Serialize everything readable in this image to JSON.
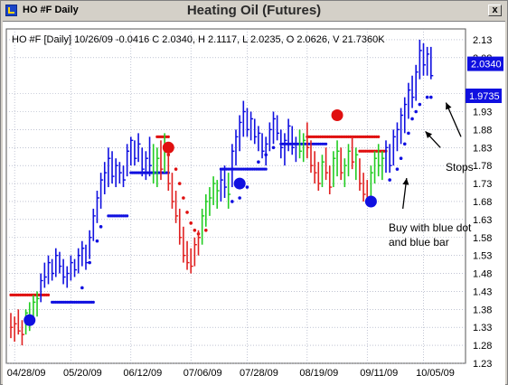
{
  "window": {
    "title": "HO #F Daily",
    "chart_title": "Heating Oil (Futures)",
    "close_glyph": "x"
  },
  "info_line": "HO #F [Daily] 10/26/09  -0.0416 C 2.0340, H 2.1117, L 2.0235, O 2.0626, V 21.7360K",
  "colors": {
    "up": "#22cc22",
    "down": "#e02020",
    "blue_bar": "#1010e0",
    "blue_dot": "#1010e0",
    "red_dot": "#e01010",
    "badge": "#1010e0",
    "grid": "#9aa0b8"
  },
  "annotations": {
    "stops": "Stops",
    "buy_line1": "Buy with blue dot",
    "buy_line2": "and blue bar"
  },
  "chart_data": {
    "type": "bar",
    "title": "Heating Oil (Futures)",
    "xlabel": "",
    "ylabel": "",
    "ylim": [
      1.23,
      2.16
    ],
    "y_ticks": [
      2.13,
      2.08,
      1.98,
      1.93,
      1.88,
      1.83,
      1.78,
      1.73,
      1.68,
      1.63,
      1.58,
      1.53,
      1.48,
      1.43,
      1.38,
      1.33,
      1.28,
      1.23
    ],
    "x_ticks": [
      {
        "label": "04/28/09",
        "bar": 1
      },
      {
        "label": "05/20/09",
        "bar": 16
      },
      {
        "label": "06/12/09",
        "bar": 32
      },
      {
        "label": "07/06/09",
        "bar": 48
      },
      {
        "label": "07/28/09",
        "bar": 63
      },
      {
        "label": "08/19/09",
        "bar": 79
      },
      {
        "label": "09/11/09",
        "bar": 95
      },
      {
        "label": "10/05/09",
        "bar": 110
      }
    ],
    "last_price": "2.0340",
    "stop_price": "1.9735",
    "bars": [
      {
        "h": 1.37,
        "l": 1.3,
        "c": 1.33,
        "k": "d"
      },
      {
        "h": 1.36,
        "l": 1.29,
        "c": 1.34,
        "k": "d"
      },
      {
        "h": 1.38,
        "l": 1.31,
        "c": 1.32,
        "k": "d"
      },
      {
        "h": 1.35,
        "l": 1.28,
        "c": 1.31,
        "k": "d"
      },
      {
        "h": 1.38,
        "l": 1.31,
        "c": 1.37,
        "k": "u"
      },
      {
        "h": 1.4,
        "l": 1.32,
        "c": 1.36,
        "k": "u"
      },
      {
        "h": 1.42,
        "l": 1.34,
        "c": 1.4,
        "k": "u"
      },
      {
        "h": 1.43,
        "l": 1.36,
        "c": 1.41,
        "k": "u"
      },
      {
        "h": 1.48,
        "l": 1.4,
        "c": 1.46,
        "k": "b"
      },
      {
        "h": 1.51,
        "l": 1.44,
        "c": 1.47,
        "k": "b"
      },
      {
        "h": 1.53,
        "l": 1.45,
        "c": 1.51,
        "k": "b"
      },
      {
        "h": 1.52,
        "l": 1.46,
        "c": 1.48,
        "k": "b"
      },
      {
        "h": 1.55,
        "l": 1.47,
        "c": 1.53,
        "k": "b"
      },
      {
        "h": 1.54,
        "l": 1.48,
        "c": 1.5,
        "k": "b"
      },
      {
        "h": 1.52,
        "l": 1.45,
        "c": 1.47,
        "k": "b"
      },
      {
        "h": 1.5,
        "l": 1.44,
        "c": 1.48,
        "k": "b"
      },
      {
        "h": 1.53,
        "l": 1.46,
        "c": 1.51,
        "k": "b"
      },
      {
        "h": 1.52,
        "l": 1.47,
        "c": 1.49,
        "k": "b"
      },
      {
        "h": 1.55,
        "l": 1.48,
        "c": 1.53,
        "k": "b"
      },
      {
        "h": 1.57,
        "l": 1.5,
        "c": 1.55,
        "k": "b"
      },
      {
        "h": 1.56,
        "l": 1.49,
        "c": 1.51,
        "k": "b"
      },
      {
        "h": 1.6,
        "l": 1.52,
        "c": 1.58,
        "k": "b"
      },
      {
        "h": 1.66,
        "l": 1.57,
        "c": 1.64,
        "k": "b"
      },
      {
        "h": 1.71,
        "l": 1.62,
        "c": 1.69,
        "k": "b"
      },
      {
        "h": 1.76,
        "l": 1.66,
        "c": 1.74,
        "k": "b"
      },
      {
        "h": 1.79,
        "l": 1.7,
        "c": 1.76,
        "k": "b"
      },
      {
        "h": 1.83,
        "l": 1.72,
        "c": 1.8,
        "k": "b"
      },
      {
        "h": 1.82,
        "l": 1.73,
        "c": 1.75,
        "k": "b"
      },
      {
        "h": 1.8,
        "l": 1.72,
        "c": 1.78,
        "k": "b"
      },
      {
        "h": 1.79,
        "l": 1.73,
        "c": 1.76,
        "k": "b"
      },
      {
        "h": 1.78,
        "l": 1.72,
        "c": 1.74,
        "k": "b"
      },
      {
        "h": 1.84,
        "l": 1.75,
        "c": 1.82,
        "k": "b"
      },
      {
        "h": 1.86,
        "l": 1.78,
        "c": 1.85,
        "k": "b"
      },
      {
        "h": 1.85,
        "l": 1.78,
        "c": 1.8,
        "k": "b"
      },
      {
        "h": 1.87,
        "l": 1.79,
        "c": 1.84,
        "k": "b"
      },
      {
        "h": 1.83,
        "l": 1.75,
        "c": 1.77,
        "k": "b"
      },
      {
        "h": 1.82,
        "l": 1.74,
        "c": 1.8,
        "k": "b"
      },
      {
        "h": 1.86,
        "l": 1.75,
        "c": 1.78,
        "k": "b"
      },
      {
        "h": 1.84,
        "l": 1.73,
        "c": 1.76,
        "k": "u"
      },
      {
        "h": 1.83,
        "l": 1.72,
        "c": 1.8,
        "k": "u"
      },
      {
        "h": 1.85,
        "l": 1.74,
        "c": 1.77,
        "k": "d"
      },
      {
        "h": 1.87,
        "l": 1.76,
        "c": 1.84,
        "k": "u"
      },
      {
        "h": 1.81,
        "l": 1.71,
        "c": 1.73,
        "k": "d"
      },
      {
        "h": 1.76,
        "l": 1.66,
        "c": 1.68,
        "k": "d"
      },
      {
        "h": 1.71,
        "l": 1.62,
        "c": 1.64,
        "k": "d"
      },
      {
        "h": 1.66,
        "l": 1.56,
        "c": 1.58,
        "k": "d"
      },
      {
        "h": 1.61,
        "l": 1.51,
        "c": 1.53,
        "k": "d"
      },
      {
        "h": 1.57,
        "l": 1.49,
        "c": 1.51,
        "k": "d"
      },
      {
        "h": 1.55,
        "l": 1.48,
        "c": 1.5,
        "k": "d"
      },
      {
        "h": 1.58,
        "l": 1.5,
        "c": 1.56,
        "k": "d"
      },
      {
        "h": 1.6,
        "l": 1.53,
        "c": 1.58,
        "k": "d"
      },
      {
        "h": 1.66,
        "l": 1.56,
        "c": 1.64,
        "k": "u"
      },
      {
        "h": 1.7,
        "l": 1.61,
        "c": 1.68,
        "k": "u"
      },
      {
        "h": 1.72,
        "l": 1.64,
        "c": 1.69,
        "k": "u"
      },
      {
        "h": 1.75,
        "l": 1.67,
        "c": 1.73,
        "k": "u"
      },
      {
        "h": 1.74,
        "l": 1.66,
        "c": 1.71,
        "k": "u"
      },
      {
        "h": 1.77,
        "l": 1.68,
        "c": 1.74,
        "k": "b"
      },
      {
        "h": 1.78,
        "l": 1.69,
        "c": 1.72,
        "k": "b"
      },
      {
        "h": 1.76,
        "l": 1.66,
        "c": 1.7,
        "k": "u"
      },
      {
        "h": 1.84,
        "l": 1.72,
        "c": 1.82,
        "k": "b"
      },
      {
        "h": 1.88,
        "l": 1.78,
        "c": 1.86,
        "k": "b"
      },
      {
        "h": 1.92,
        "l": 1.82,
        "c": 1.9,
        "k": "b"
      },
      {
        "h": 1.96,
        "l": 1.86,
        "c": 1.93,
        "k": "b"
      },
      {
        "h": 1.94,
        "l": 1.86,
        "c": 1.88,
        "k": "b"
      },
      {
        "h": 1.93,
        "l": 1.85,
        "c": 1.91,
        "k": "b"
      },
      {
        "h": 1.91,
        "l": 1.84,
        "c": 1.86,
        "k": "b"
      },
      {
        "h": 1.89,
        "l": 1.82,
        "c": 1.87,
        "k": "b"
      },
      {
        "h": 1.87,
        "l": 1.8,
        "c": 1.82,
        "k": "b"
      },
      {
        "h": 1.86,
        "l": 1.78,
        "c": 1.84,
        "k": "b"
      },
      {
        "h": 1.9,
        "l": 1.82,
        "c": 1.88,
        "k": "b"
      },
      {
        "h": 1.93,
        "l": 1.84,
        "c": 1.91,
        "k": "b"
      },
      {
        "h": 1.92,
        "l": 1.85,
        "c": 1.87,
        "k": "b"
      },
      {
        "h": 1.88,
        "l": 1.8,
        "c": 1.83,
        "k": "b"
      },
      {
        "h": 1.87,
        "l": 1.78,
        "c": 1.85,
        "k": "b"
      },
      {
        "h": 1.91,
        "l": 1.82,
        "c": 1.89,
        "k": "b"
      },
      {
        "h": 1.89,
        "l": 1.81,
        "c": 1.83,
        "k": "b"
      },
      {
        "h": 1.86,
        "l": 1.79,
        "c": 1.84,
        "k": "b"
      },
      {
        "h": 1.88,
        "l": 1.8,
        "c": 1.82,
        "k": "u"
      },
      {
        "h": 1.87,
        "l": 1.79,
        "c": 1.85,
        "k": "u"
      },
      {
        "h": 1.9,
        "l": 1.8,
        "c": 1.83,
        "k": "d"
      },
      {
        "h": 1.85,
        "l": 1.76,
        "c": 1.78,
        "k": "d"
      },
      {
        "h": 1.82,
        "l": 1.73,
        "c": 1.76,
        "k": "d"
      },
      {
        "h": 1.79,
        "l": 1.71,
        "c": 1.73,
        "k": "d"
      },
      {
        "h": 1.81,
        "l": 1.72,
        "c": 1.79,
        "k": "u"
      },
      {
        "h": 1.83,
        "l": 1.74,
        "c": 1.76,
        "k": "d"
      },
      {
        "h": 1.78,
        "l": 1.7,
        "c": 1.72,
        "k": "d"
      },
      {
        "h": 1.82,
        "l": 1.72,
        "c": 1.8,
        "k": "u"
      },
      {
        "h": 1.85,
        "l": 1.75,
        "c": 1.82,
        "k": "u"
      },
      {
        "h": 1.83,
        "l": 1.74,
        "c": 1.76,
        "k": "d"
      },
      {
        "h": 1.8,
        "l": 1.72,
        "c": 1.78,
        "k": "u"
      },
      {
        "h": 1.84,
        "l": 1.75,
        "c": 1.82,
        "k": "u"
      },
      {
        "h": 1.86,
        "l": 1.77,
        "c": 1.79,
        "k": "d"
      },
      {
        "h": 1.83,
        "l": 1.74,
        "c": 1.81,
        "k": "u"
      },
      {
        "h": 1.8,
        "l": 1.71,
        "c": 1.73,
        "k": "d"
      },
      {
        "h": 1.76,
        "l": 1.68,
        "c": 1.7,
        "k": "d"
      },
      {
        "h": 1.74,
        "l": 1.67,
        "c": 1.69,
        "k": "d"
      },
      {
        "h": 1.78,
        "l": 1.69,
        "c": 1.76,
        "k": "u"
      },
      {
        "h": 1.82,
        "l": 1.73,
        "c": 1.8,
        "k": "u"
      },
      {
        "h": 1.84,
        "l": 1.75,
        "c": 1.78,
        "k": "u"
      },
      {
        "h": 1.82,
        "l": 1.74,
        "c": 1.8,
        "k": "u"
      },
      {
        "h": 1.85,
        "l": 1.76,
        "c": 1.83,
        "k": "b"
      },
      {
        "h": 1.84,
        "l": 1.76,
        "c": 1.78,
        "k": "b"
      },
      {
        "h": 1.88,
        "l": 1.78,
        "c": 1.86,
        "k": "b"
      },
      {
        "h": 1.9,
        "l": 1.82,
        "c": 1.88,
        "k": "b"
      },
      {
        "h": 1.94,
        "l": 1.84,
        "c": 1.92,
        "k": "b"
      },
      {
        "h": 1.97,
        "l": 1.87,
        "c": 1.95,
        "k": "b"
      },
      {
        "h": 2.01,
        "l": 1.91,
        "c": 1.99,
        "k": "b"
      },
      {
        "h": 2.03,
        "l": 1.94,
        "c": 1.97,
        "k": "b"
      },
      {
        "h": 2.06,
        "l": 1.96,
        "c": 2.04,
        "k": "b"
      },
      {
        "h": 2.13,
        "l": 2.02,
        "c": 2.1,
        "k": "b"
      },
      {
        "h": 2.12,
        "l": 2.03,
        "c": 2.06,
        "k": "b"
      },
      {
        "h": 2.11,
        "l": 2.03,
        "c": 2.09,
        "k": "b"
      },
      {
        "h": 2.11,
        "l": 2.02,
        "c": 2.03,
        "k": "b"
      }
    ],
    "red_stops": [
      {
        "from": 0,
        "to": 10,
        "y": 1.42
      },
      {
        "from": 39,
        "to": 42,
        "y": 1.86
      },
      {
        "from": 79,
        "to": 98,
        "y": 1.86
      },
      {
        "from": 93,
        "to": 100,
        "y": 1.82
      }
    ],
    "blue_stops": [
      {
        "from": 11,
        "to": 22,
        "y": 1.4
      },
      {
        "from": 26,
        "to": 31,
        "y": 1.64
      },
      {
        "from": 32,
        "to": 42,
        "y": 1.76
      },
      {
        "from": 56,
        "to": 68,
        "y": 1.77
      },
      {
        "from": 72,
        "to": 84,
        "y": 1.84
      }
    ],
    "red_trail": [
      [
        42,
        1.81
      ],
      [
        44,
        1.77
      ],
      [
        45,
        1.73
      ],
      [
        46,
        1.69
      ],
      [
        47,
        1.65
      ],
      [
        48,
        1.62
      ],
      [
        49,
        1.6
      ],
      [
        50,
        1.59
      ],
      [
        52,
        1.6
      ]
    ],
    "blue_trail": [
      [
        19,
        1.44
      ],
      [
        21,
        1.51
      ],
      [
        23,
        1.57
      ],
      [
        24,
        1.61
      ],
      [
        59,
        1.68
      ],
      [
        61,
        1.69
      ],
      [
        63,
        1.72
      ],
      [
        66,
        1.79
      ],
      [
        68,
        1.81
      ],
      [
        70,
        1.83
      ],
      [
        101,
        1.74
      ],
      [
        103,
        1.77
      ],
      [
        104,
        1.8
      ],
      [
        105,
        1.84
      ],
      [
        106,
        1.87
      ],
      [
        107,
        1.91
      ],
      [
        108,
        1.93
      ],
      [
        109,
        1.95
      ],
      [
        111,
        1.97
      ],
      [
        112,
        1.97
      ]
    ],
    "big_red_dots": [
      [
        42,
        1.83
      ],
      [
        87,
        1.92
      ]
    ],
    "big_blue_dots": [
      [
        5,
        1.35
      ],
      [
        61,
        1.73
      ],
      [
        96,
        1.68
      ]
    ],
    "arrows": [
      {
        "from": [
          120,
          1.87
        ],
        "to": [
          112,
          1.96
        ]
      },
      {
        "from": [
          114,
          1.83
        ],
        "to": [
          110,
          1.88
        ]
      },
      {
        "from": [
          101,
          1.66
        ],
        "to": [
          105,
          1.74
        ]
      },
      {
        "from": [
          104,
          1.75
        ],
        "to": [
          104,
          1.75
        ]
      }
    ]
  }
}
